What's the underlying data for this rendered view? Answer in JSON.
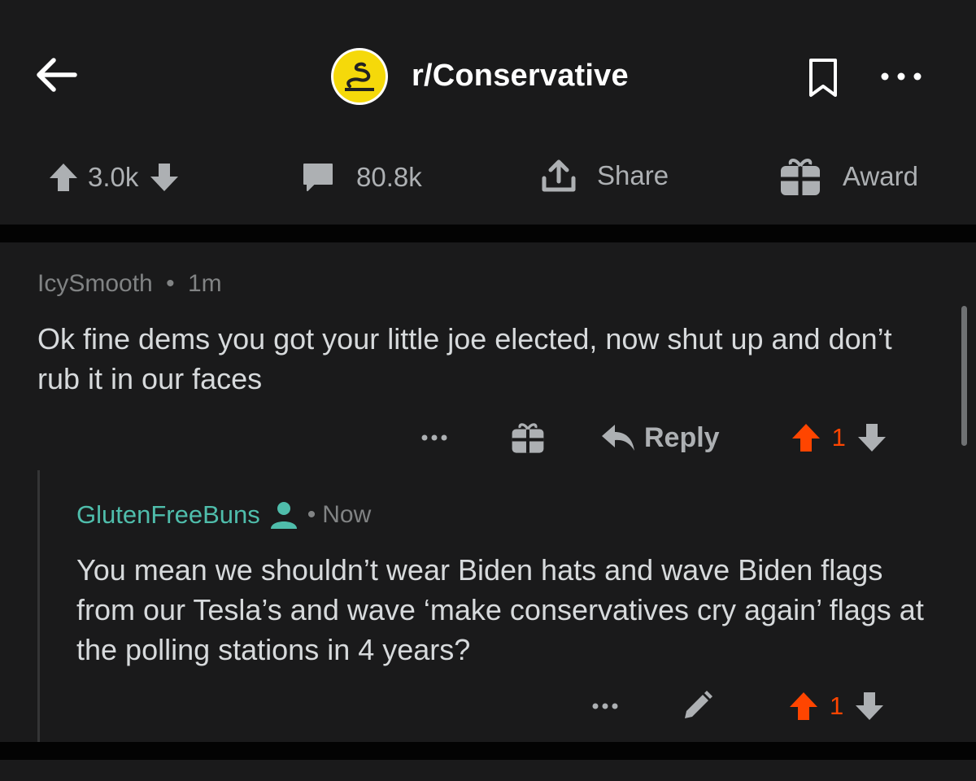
{
  "colors": {
    "background": "#1a1a1b",
    "separator": "#030303",
    "upvote_active": "#ff4500",
    "username_highlight": "#4fbdab",
    "muted_text": "#818384",
    "icon_gray": "#adb0b3"
  },
  "header": {
    "back_icon": "arrow-left-icon",
    "subreddit_avatar_icon": "gadsden-flag-snake-icon",
    "subreddit_name": "r/Conservative",
    "bookmark_icon": "bookmark-icon",
    "more_icon": "more-horizontal-icon"
  },
  "post_actions": {
    "score": "3.0k",
    "comments_count": "80.8k",
    "share_label": "Share",
    "award_label": "Award"
  },
  "comments": [
    {
      "author": "IcySmooth",
      "separator": "•",
      "time": "1m",
      "body": "Ok fine dems you got your little joe elected, now shut up and don’t rub it in our faces",
      "reply_label": "Reply",
      "score": "1",
      "upvoted": true
    },
    {
      "author": "GlutenFreeBuns",
      "author_icon": "user-icon",
      "separator": "•",
      "time": "Now",
      "body": "You mean we shouldn’t wear Biden hats and wave Biden flags from our Tesla’s and wave ‘make conservatives cry again’ flags at the polling stations in 4 years?",
      "score": "1",
      "upvoted": true
    }
  ]
}
